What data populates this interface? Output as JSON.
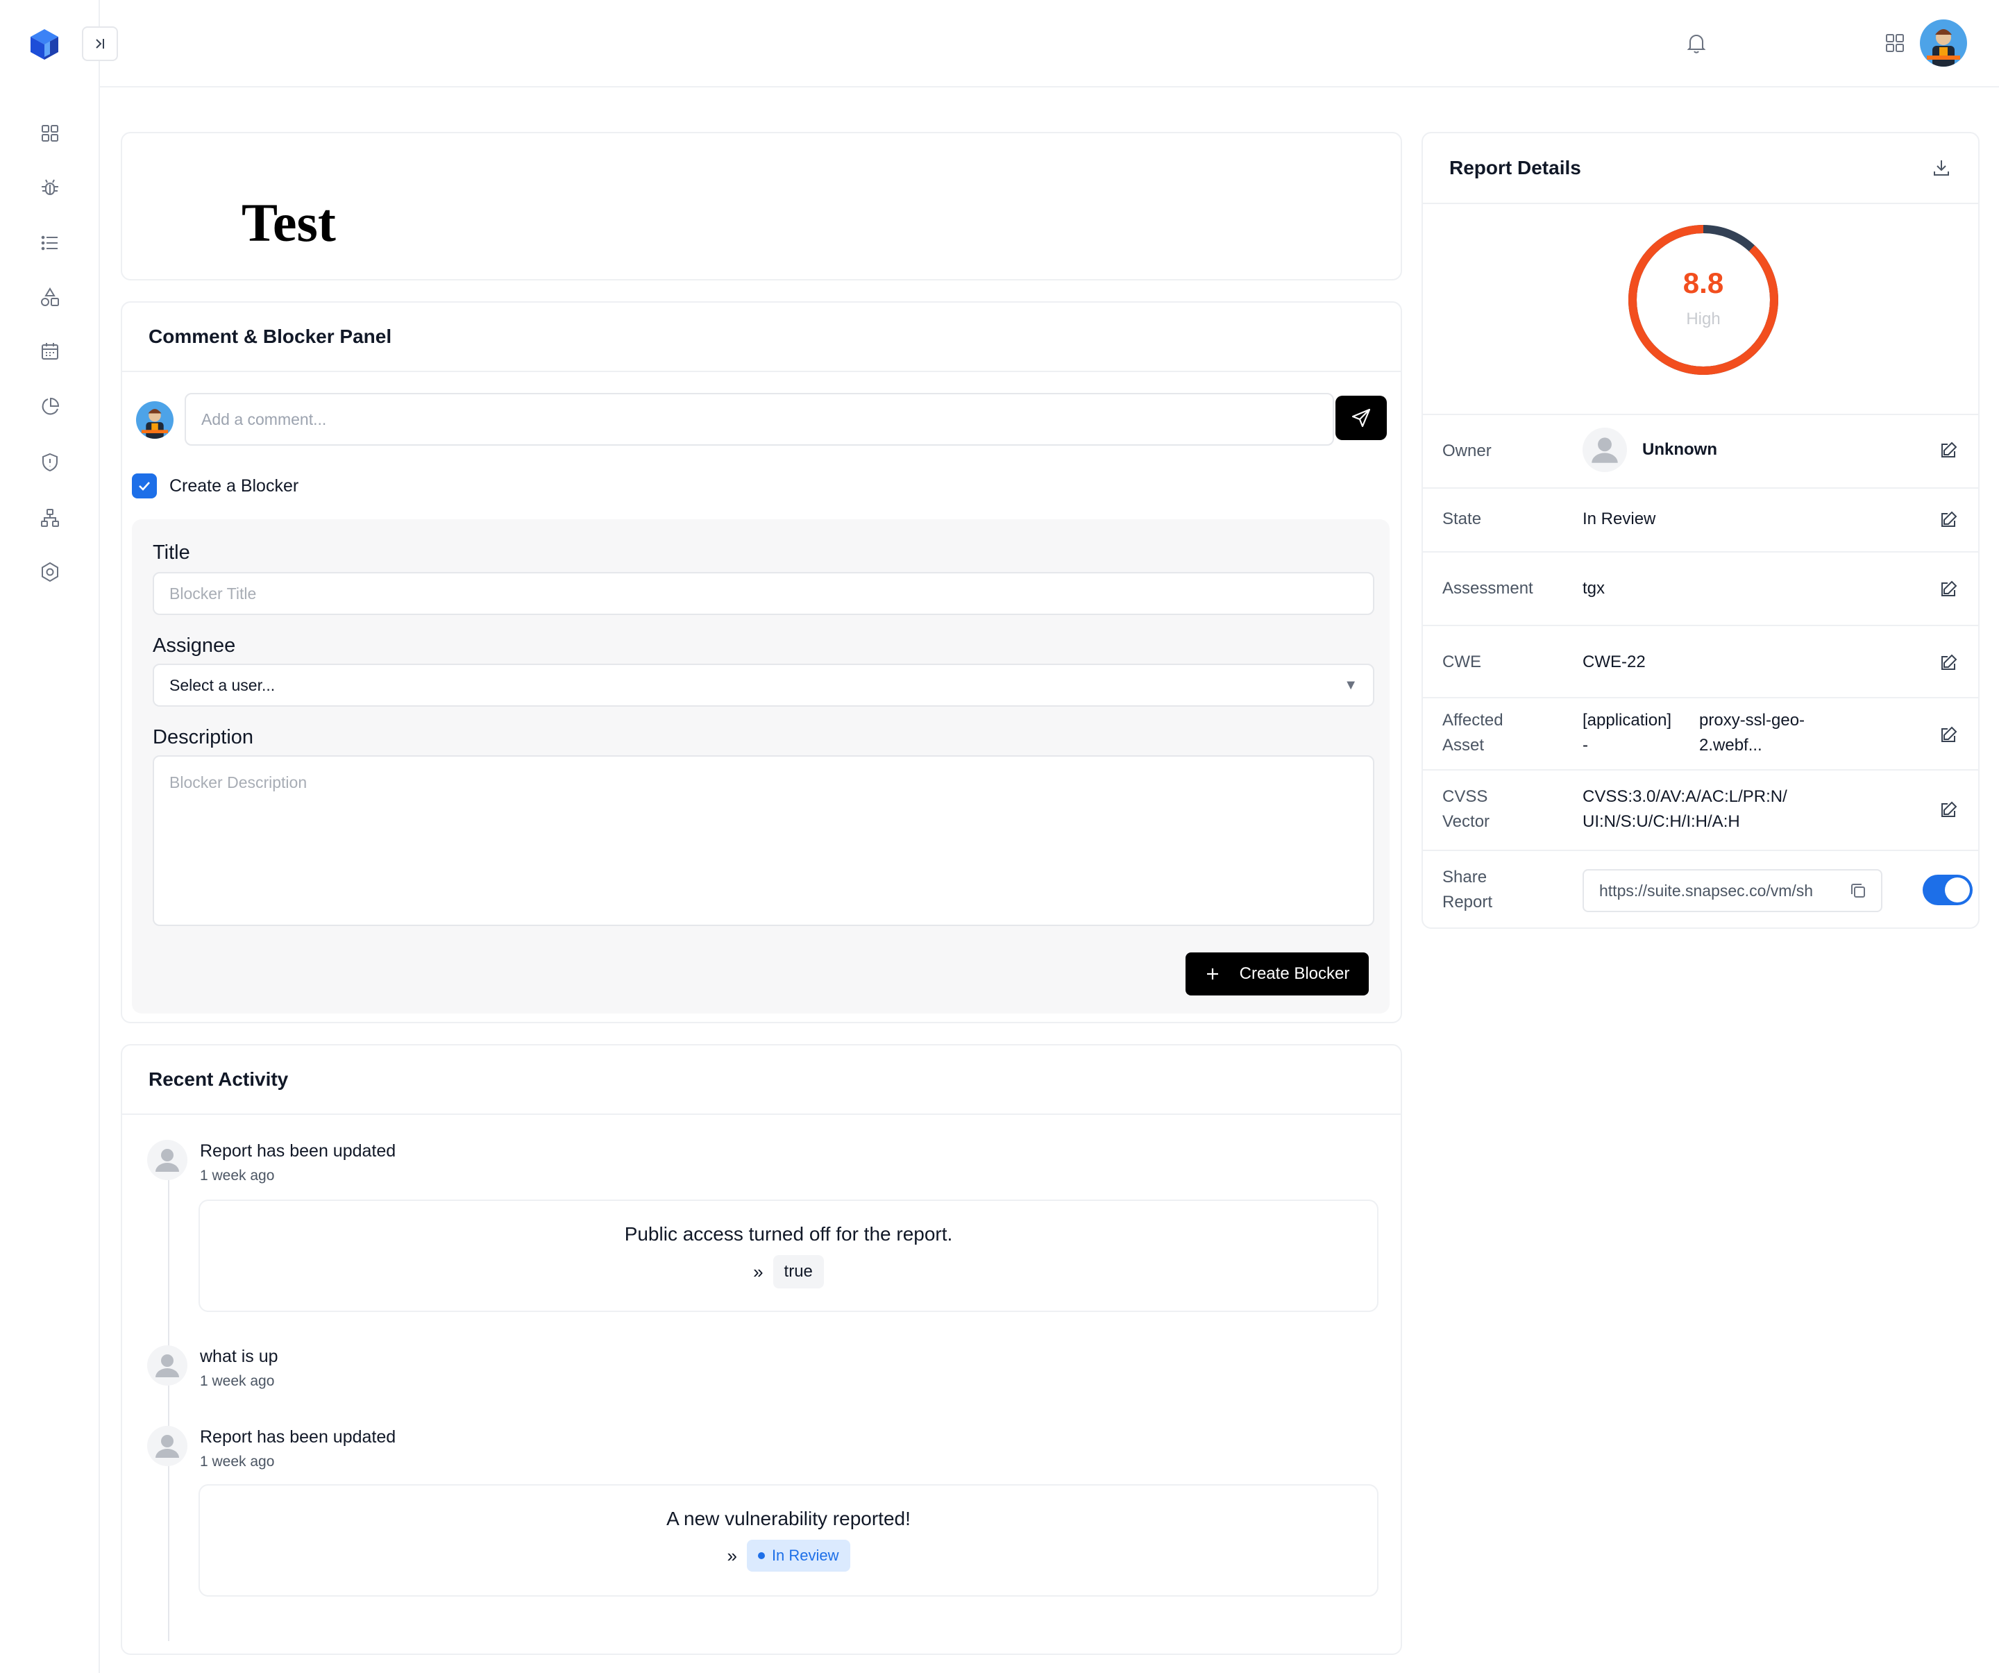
{
  "colors": {
    "accent": "#1d6fe8",
    "score": "#f24e1e",
    "gauge_track": "#334155"
  },
  "icons": {
    "logo": "cube-logo-icon",
    "sidebar": [
      "dashboard-grid-icon",
      "bug-icon",
      "list-icon",
      "shapes-icon",
      "calendar-icon",
      "pie-chart-icon",
      "shield-icon",
      "network-icon",
      "settings-hexagon-icon"
    ],
    "topbar": [
      "bell-icon",
      "apps-grid-icon"
    ]
  },
  "page": {
    "title": "Test"
  },
  "comment_panel": {
    "title": "Comment & Blocker Panel",
    "comment_placeholder": "Add a comment...",
    "create_blocker_label": "Create a Blocker",
    "create_blocker_checked": true,
    "form": {
      "title_label": "Title",
      "title_placeholder": "Blocker Title",
      "assignee_label": "Assignee",
      "assignee_value": "Select a user...",
      "description_label": "Description",
      "description_placeholder": "Blocker Description",
      "submit_label": "Create Blocker"
    }
  },
  "activity": {
    "title": "Recent Activity",
    "items": [
      {
        "title": "Report has been updated",
        "time": "1 week ago",
        "detail": "Public access turned off for the report.",
        "value": "true"
      },
      {
        "title": "what is up",
        "time": "1 week ago"
      },
      {
        "title": "Report has been updated",
        "time": "1 week ago",
        "detail": "A new vulnerability reported!",
        "value": "In Review"
      }
    ]
  },
  "report": {
    "title": "Report Details",
    "score": "8.8",
    "severity": "High",
    "score_fraction": 0.88,
    "rows": {
      "owner": {
        "label": "Owner",
        "value": "Unknown"
      },
      "state": {
        "label": "State",
        "value": "In Review"
      },
      "assessment": {
        "label": "Assessment",
        "value": "tgx"
      },
      "cwe": {
        "label": "CWE",
        "value": "CWE-22"
      },
      "asset": {
        "label_1": "Affected",
        "label_2": "Asset",
        "type_1": "[application]",
        "type_2": "-",
        "value_1": "proxy-ssl-geo-",
        "value_2": "2.webf..."
      },
      "cvss": {
        "label_1": "CVSS",
        "label_2": "Vector",
        "value_1": "CVSS:3.0/AV:A/AC:L/PR:N/",
        "value_2": "UI:N/S:U/C:H/I:H/A:H"
      },
      "share": {
        "label_1": "Share",
        "label_2": "Report",
        "url": "https://suite.snapsec.co/vm/sh",
        "enabled": true
      }
    }
  }
}
